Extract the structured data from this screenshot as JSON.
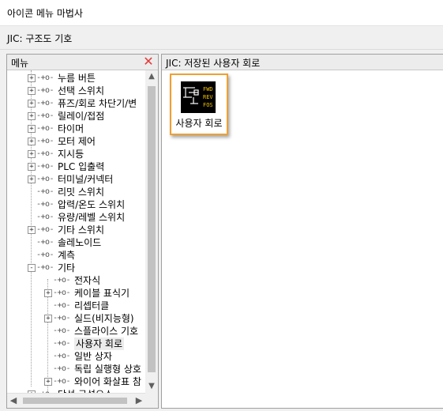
{
  "window": {
    "title": "아이콘 메뉴 마법사"
  },
  "header": {
    "subtitle": "JIC: 구조도 기호"
  },
  "left_panel": {
    "title": "메뉴",
    "close_icon": "close-x-icon",
    "tree": [
      {
        "label": "누름 버튼",
        "expander": "+"
      },
      {
        "label": "선택 스위치",
        "expander": "+"
      },
      {
        "label": "퓨즈/회로 차단기/변",
        "expander": "+"
      },
      {
        "label": "릴레이/접점",
        "expander": "+"
      },
      {
        "label": "타이머",
        "expander": "+"
      },
      {
        "label": "모터 제어",
        "expander": "+"
      },
      {
        "label": "지시등",
        "expander": "+"
      },
      {
        "label": "PLC 입출력",
        "expander": "+"
      },
      {
        "label": "터미널/커넥터",
        "expander": "+"
      },
      {
        "label": "리밋 스위치",
        "expander": ""
      },
      {
        "label": "압력/온도 스위치",
        "expander": ""
      },
      {
        "label": "유량/레벨 스위치",
        "expander": ""
      },
      {
        "label": "기타 스위치",
        "expander": "+"
      },
      {
        "label": "솔레노이드",
        "expander": ""
      },
      {
        "label": "계측",
        "expander": ""
      },
      {
        "label": "기타",
        "expander": "−"
      },
      {
        "label": "전자식",
        "expander": ""
      },
      {
        "label": "케이블 표식기",
        "expander": "+"
      },
      {
        "label": "리셉터클",
        "expander": ""
      },
      {
        "label": "실드(비지능형)",
        "expander": "+"
      },
      {
        "label": "스플라이스 기호",
        "expander": ""
      },
      {
        "label": "사용자 회로",
        "expander": ""
      },
      {
        "label": "일반 상자",
        "expander": ""
      },
      {
        "label": "독립 실행형 상호",
        "expander": ""
      },
      {
        "label": "와이어 화살표 참",
        "expander": "+"
      },
      {
        "label": "단선 구성요소",
        "expander": "+"
      }
    ]
  },
  "right_panel": {
    "title": "JIC: 저장된 사용자 회로",
    "items": [
      {
        "label": "사용자 회로",
        "icon": "user-circuit-icon",
        "icon_lines": [
          "FWD",
          "REV",
          "FOS"
        ]
      }
    ]
  },
  "colors": {
    "accent": "#f0a030",
    "close": "#e53935"
  }
}
